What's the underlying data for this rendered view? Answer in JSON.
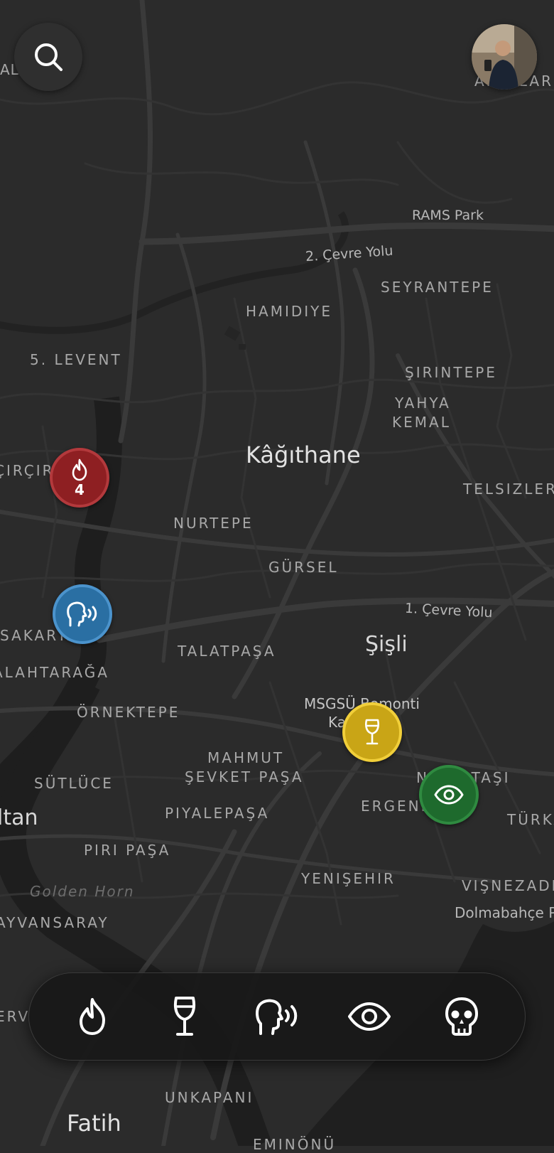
{
  "map": {
    "labels": {
      "rams_park": "RAMS Park",
      "cevre_yolu_2": "2. Çevre Yolu",
      "seyrantepe": "SEYRANTEPE",
      "hamidiye": "HAMIDIYE",
      "levent5": "5. LEVENT",
      "sirintepe": "ŞIRINTEPE",
      "yahya": "YAHYA",
      "kemal": "KEMAL",
      "kagithane": "Kâğıthane",
      "telsizler": "TELSIZLER",
      "circir": "ÇIRÇIR",
      "nurtepe": "NURTEPE",
      "gursel": "GÜRSEL",
      "cevre_yolu_1": "1. Çevre Yolu",
      "sakarya": "SAKARYA",
      "sisli": "Şişli",
      "talatpasa": "TALATPAŞA",
      "alibeykoy": "ALIB",
      "akatlar": "AKATLAR",
      "kagithane_pin_ocak": "ALAHTARAĞA",
      "ornektepe": "ÖRNEKTEPE",
      "msgsu": "MSGSÜ Bomonti",
      "msgsu2": "Kampüsü",
      "mahmut": "MAHMUT",
      "sevket": "ŞEVKET PAŞA",
      "nisantasi": "NIŞANTAŞI",
      "sutluce": "SÜTLÜCE",
      "eyup": "ltan",
      "ergenekon": "ERGENEKON",
      "turkali": "TÜRKALI",
      "piyalepasa": "PIYALEPAŞA",
      "piripasa": "PIRI PAŞA",
      "yenisehir": "YENIŞEHIR",
      "visnezade": "VIŞNEZADE",
      "golden_horn": "Golden Horn",
      "dolmabahce": "Dolmabahçe P",
      "ayvansaray": "AYVANSARAY",
      "erv": "ERV",
      "unkapani": "UNKAPANI",
      "fatih": "Fatih",
      "eminonu": "EMINÖNÜ"
    }
  },
  "pins": [
    {
      "id": "fire",
      "icon": "fire-icon",
      "color": "#8e1f22",
      "border": "#b3393c",
      "count": "4"
    },
    {
      "id": "voice",
      "icon": "speaking-head-icon",
      "color": "#2a6fa3",
      "border": "#4b93cc"
    },
    {
      "id": "wine",
      "icon": "wine-glass-icon",
      "color": "#c9a516",
      "border": "#f1cf3a"
    },
    {
      "id": "eye",
      "icon": "eye-icon",
      "color": "#1e6a2d",
      "border": "#2f8a40"
    }
  ],
  "dock": {
    "items": [
      {
        "id": "fire",
        "icon": "fire-icon"
      },
      {
        "id": "wine",
        "icon": "wine-glass-icon"
      },
      {
        "id": "voice",
        "icon": "speaking-head-icon"
      },
      {
        "id": "eye",
        "icon": "eye-icon"
      },
      {
        "id": "skull",
        "icon": "skull-icon"
      }
    ]
  }
}
